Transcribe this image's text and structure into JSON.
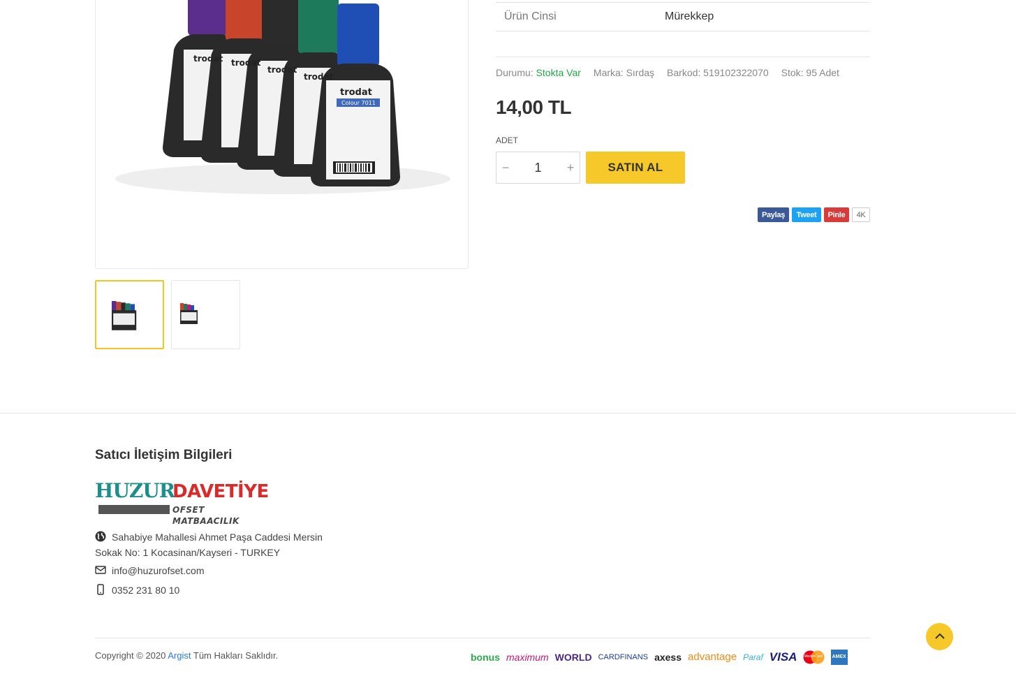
{
  "product": {
    "spec": {
      "key": "Ürün Cinsi",
      "value": "Mürekkep"
    },
    "status_label": "Durumu:",
    "status_value": "Stokta Var",
    "brand": "Marka: Sırdaş",
    "barcode": "Barkod: 519102322070",
    "stock": "Stok: 95 Adet",
    "price": "14,00 TL",
    "qty_label": "ADET",
    "qty_value": "1",
    "buy_label": "SATIN AL",
    "bottle_labels": [
      "trodat",
      "trodat",
      "trodat",
      "trodat",
      "trodat"
    ],
    "bottle_colors": [
      "#5b2d8c",
      "#c8452c",
      "#2b2b2b",
      "#1d7a5a",
      "#1f4fb5"
    ],
    "colour_label": "Colour 7011"
  },
  "share": {
    "facebook": "Paylaş",
    "twitter": "Tweet",
    "pinterest": "Pinle",
    "count": "4K"
  },
  "footer": {
    "seller_title": "Satıcı İletişim Bilgileri",
    "logo": {
      "huzur": "HUZUR",
      "davetiye": "DAVETİYE",
      "ofset": "OFSET MATBAACILIK"
    },
    "address_line1": "Sahabiye Mahallesi Ahmet Paşa Caddesi Mersin",
    "address_line2": "Sokak No: 1 Kocasinan/Kayseri - TURKEY",
    "email": "info@huzurofset.com",
    "phone": "0352 231 80 10",
    "copyright_prefix": "Copyright © 2020",
    "copyright_link": "Argist",
    "copyright_suffix": "Tüm Hakları Saklıdır.",
    "cards": [
      {
        "name": "bonus",
        "color": "#2fa84f"
      },
      {
        "name": "maximum",
        "color": "#c2187a"
      },
      {
        "name": "WORLD",
        "color": "#4b2a7b"
      },
      {
        "name": "CARDFINANS",
        "color": "#1d3f8f"
      },
      {
        "name": "axess",
        "color": "#222222"
      },
      {
        "name": "advantage",
        "color": "#f08a1c"
      },
      {
        "name": "Paraf",
        "color": "#3ab0d8"
      },
      {
        "name": "VISA",
        "color": "#1a1f71"
      },
      {
        "name": "MasterCard",
        "color": "#eb001b"
      },
      {
        "name": "AMEX",
        "color": "#2e77bc"
      }
    ]
  }
}
